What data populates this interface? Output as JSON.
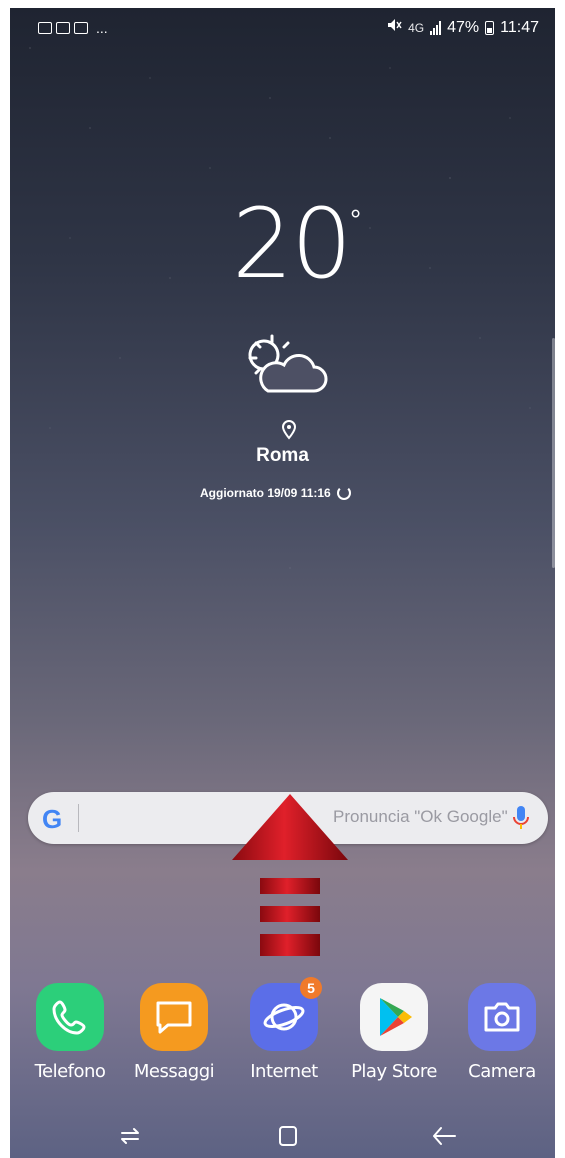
{
  "status_bar": {
    "notification_icons": [
      "gallery-icon",
      "mail-icon",
      "message-icon"
    ],
    "overflow": "...",
    "small_label": "4G",
    "battery": "47%",
    "time": "11:47"
  },
  "weather": {
    "temperature": "20",
    "degree_symbol": "°",
    "condition_icon": "partly-cloudy-night-icon",
    "city": "Roma",
    "updated": "Aggiornato 19/09 11:16"
  },
  "search": {
    "logo": "G",
    "placeholder": "Pronuncia \"Ok Google\""
  },
  "dock": {
    "apps": [
      {
        "label": "Telefono",
        "icon": "phone-icon",
        "color": "#2ccf7a"
      },
      {
        "label": "Messaggi",
        "icon": "messages-icon",
        "color": "#f59a1f"
      },
      {
        "label": "Internet",
        "icon": "internet-icon",
        "color": "#5b6ee8",
        "badge": "5"
      },
      {
        "label": "Play Store",
        "icon": "play-store-icon",
        "color": "#f5f5f5"
      },
      {
        "label": "Camera",
        "icon": "camera-icon",
        "color": "#6c78e6"
      }
    ]
  },
  "navigation": [
    "recent-apps-icon",
    "home-icon",
    "back-icon"
  ],
  "overlay": {
    "arrow_color": "#c0121b"
  }
}
